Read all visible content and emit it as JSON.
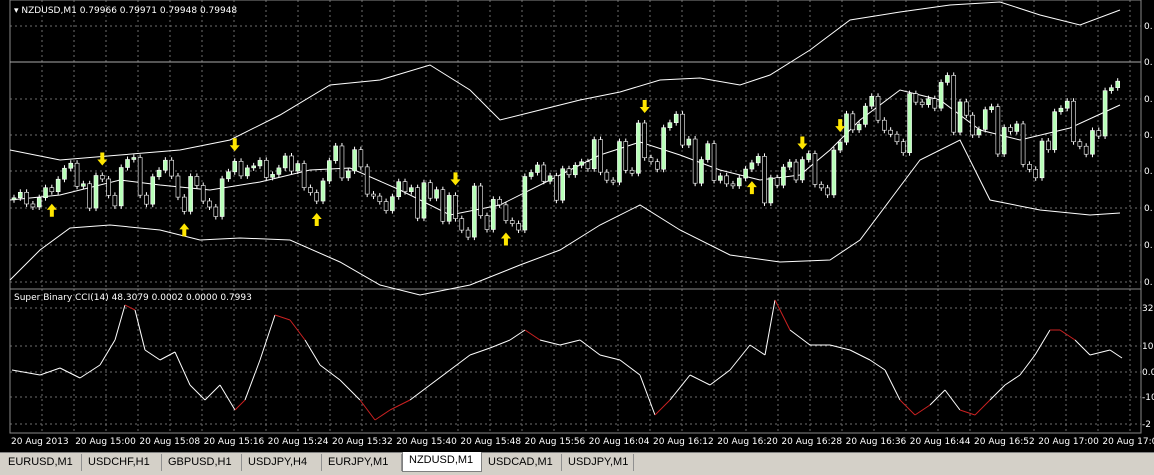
{
  "main_chart": {
    "symbol": "NZDUSD,M1",
    "quotes": "0.79966 0.79971 0.79948 0.79948",
    "price_tick_labels": [
      "0.",
      "0.",
      "0.",
      "0.",
      "0.",
      "0.",
      "0.",
      "0."
    ]
  },
  "indicator": {
    "label": "Super Binary CCI(14) 48.3079 0.0002 0.0000 0.7993",
    "tick_labels": [
      "32",
      "10",
      "0.0",
      "-10",
      "-2"
    ]
  },
  "time_axis": [
    "20 Aug 2013",
    "20 Aug 15:00",
    "20 Aug 15:08",
    "20 Aug 15:16",
    "20 Aug 15:24",
    "20 Aug 15:32",
    "20 Aug 15:40",
    "20 Aug 15:48",
    "20 Aug 15:56",
    "20 Aug 16:04",
    "20 Aug 16:12",
    "20 Aug 16:20",
    "20 Aug 16:28",
    "20 Aug 16:36",
    "20 Aug 16:44",
    "20 Aug 16:52",
    "20 Aug 17:00",
    "20 Aug 17:08"
  ],
  "tabs": [
    {
      "label": "EURUSD,M1",
      "active": false
    },
    {
      "label": "USDCHF,H1",
      "active": false
    },
    {
      "label": "GBPUSD,H1",
      "active": false
    },
    {
      "label": "USDJPY,H4",
      "active": false
    },
    {
      "label": "EURJPY,M1",
      "active": false
    },
    {
      "label": "NZDUSD,M1",
      "active": true
    },
    {
      "label": "USDCAD,M1",
      "active": false
    },
    {
      "label": "USDJPY,M1",
      "active": false
    }
  ],
  "colors": {
    "background": "#000000",
    "bull_candle": "#b8ffb8",
    "bear_candle": "#ffffff",
    "bands": "#ffffff",
    "arrow": "#ffe600",
    "cci_line": "#ffffff",
    "cci_extreme": "#cc2222",
    "grid": "#6e6e6e"
  },
  "chart_data": {
    "type": "line",
    "candle_sequence": "b b r r b b r b b b r b r b r r r b b b r r b b b r r r b r r r r b b b r b b b r b b b r b r r r b b b r b b r r r r r b b r b r b r b r b r r r b r r b r r r r b b b r b r b r b b r b r r r b r r b r r r b b b r b r b b r b r r b b b b r b r b b r b b r r r b b b r b b b r r r r r b r r b r b b r b r r b b b r b r b r r r b r b b b r r r b r b b b",
    "arrows": [
      {
        "type": "up",
        "time_index": 6
      },
      {
        "type": "down",
        "time_index": 14
      },
      {
        "type": "up",
        "time_index": 27
      },
      {
        "type": "down",
        "time_index": 35
      },
      {
        "type": "up",
        "time_index": 48
      },
      {
        "type": "down",
        "time_index": 70
      },
      {
        "type": "up",
        "time_index": 78
      },
      {
        "type": "down",
        "time_index": 100
      },
      {
        "type": "up",
        "time_index": 117
      },
      {
        "type": "down",
        "time_index": 125
      },
      {
        "type": "down",
        "time_index": 131
      }
    ]
  }
}
